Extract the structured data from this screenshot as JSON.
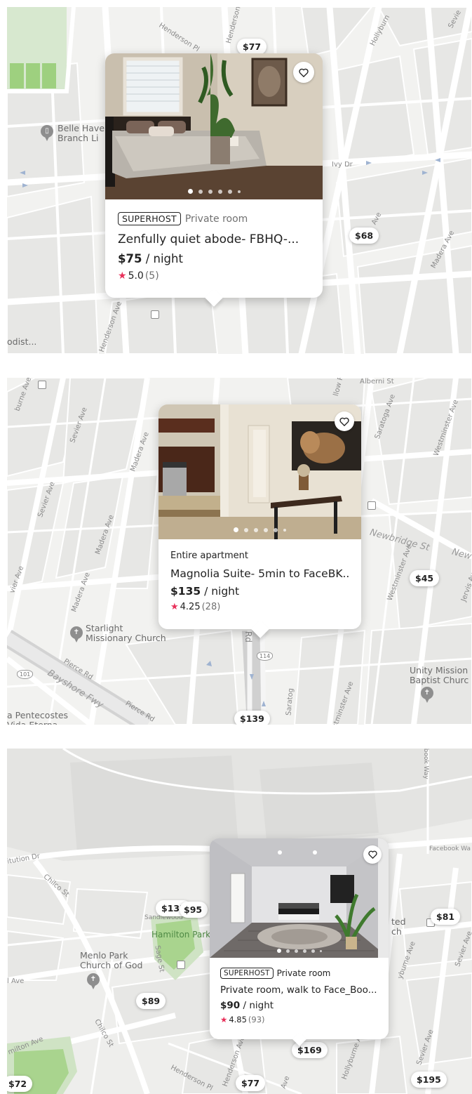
{
  "panel1": {
    "card": {
      "badge": "SUPERHOST",
      "room_type": "Private room",
      "title": "Zenfully quiet abode- FBHQ-...",
      "price": "$75",
      "per_night": " / night",
      "rating": "5.0",
      "reviews": "(5)",
      "photo_count": 6,
      "active_photo": 1
    },
    "pins": [
      "$77",
      "$68"
    ],
    "labels": {
      "poi": "Belle Have\nBranch Li",
      "ivy": "Ivy Dr",
      "henderson_pl": "Henderson Pl",
      "henderson": "Henderson",
      "hollyburn": "Hollyburn",
      "sevier": "Sevie",
      "ave": "Ave",
      "madera": "Madera Ave",
      "henderson_ave": "Henderson Ave",
      "methodist": "odist..."
    }
  },
  "panel2": {
    "card": {
      "room_type": "Entire apartment",
      "title": "Magnolia Suite- 5min to FaceBK...",
      "price": "$135",
      "per_night": " / night",
      "rating": "4.25",
      "reviews": "(28)",
      "photo_count": 6,
      "active_photo": 1
    },
    "pins": [
      "$45",
      "$139"
    ],
    "labels": {
      "starlight": "Starlight\nMissionary Church",
      "unity": "Unity Mission\nBaptist Churc",
      "pentecostes": "a Pentecostes\nVida Eterna",
      "newbridge": "Newbridge St",
      "newb2": "New",
      "bayshore": "Bayshore Fwy",
      "pierce1": "Pierce Rd",
      "pierce2": "Pierce Rd",
      "saratoga": "Saratoga Ave",
      "saratoga2": "Saratog",
      "westminster": "Westminster Ave",
      "westminster2": "Westminster Ave",
      "westminster3": "stminster Ave",
      "jervis": "Jervis Ave",
      "madera": "Madera Ave",
      "madera2": "Madera Ave",
      "madera3": "Madera Ave",
      "sevier": "Sevier Ave",
      "sevier2": "Sevier Ave",
      "sevier3": "vier Ave",
      "burne": "burne Ave",
      "alberni": "Alberni St",
      "willow": "llow R",
      "rd": "Rd",
      "hwy101": "101",
      "hwy114": "114"
    }
  },
  "panel3": {
    "card": {
      "badge": "SUPERHOST",
      "room_type": "Private room",
      "title": "Private room, walk to Face_Boo...",
      "price": "$90",
      "per_night": " / night",
      "rating": "4.85",
      "reviews": "(93)",
      "photo_count": 6,
      "active_photo": 1
    },
    "pins": [
      "$135",
      "$95",
      "$81",
      "$89",
      "$169",
      "$77",
      "$195",
      "$72"
    ],
    "labels": {
      "hamilton_park": "Hamilton Park",
      "menlo": "Menlo Park\nChurch of God",
      "sandlewood": "Sandlewood",
      "institution": "itution Dr",
      "chilco": "Chilco St",
      "chilco2": "Chilco St",
      "sage": "Sage St",
      "ave": "l Ave",
      "hamilton_ave": "milton Ave",
      "henderson_pl": "Henderson Pl",
      "henderson_ave": "Henderson Ave",
      "hollyburne": "Hollyburne Ave",
      "sevier": "Sevier Ave",
      "sevier2": "Sevier Ave",
      "facebook_way": "Facebook Wa",
      "ebook_way": "ebook Way",
      "ted": "ted\nch",
      "ave2": "Ave",
      "hollyburne2": "ybume Ave"
    }
  },
  "colors": {
    "map_bg": "#f2f2f0",
    "road": "#ffffff",
    "block": "#e8e8e8",
    "park": "#a8d58f",
    "star": "#e8305a"
  }
}
